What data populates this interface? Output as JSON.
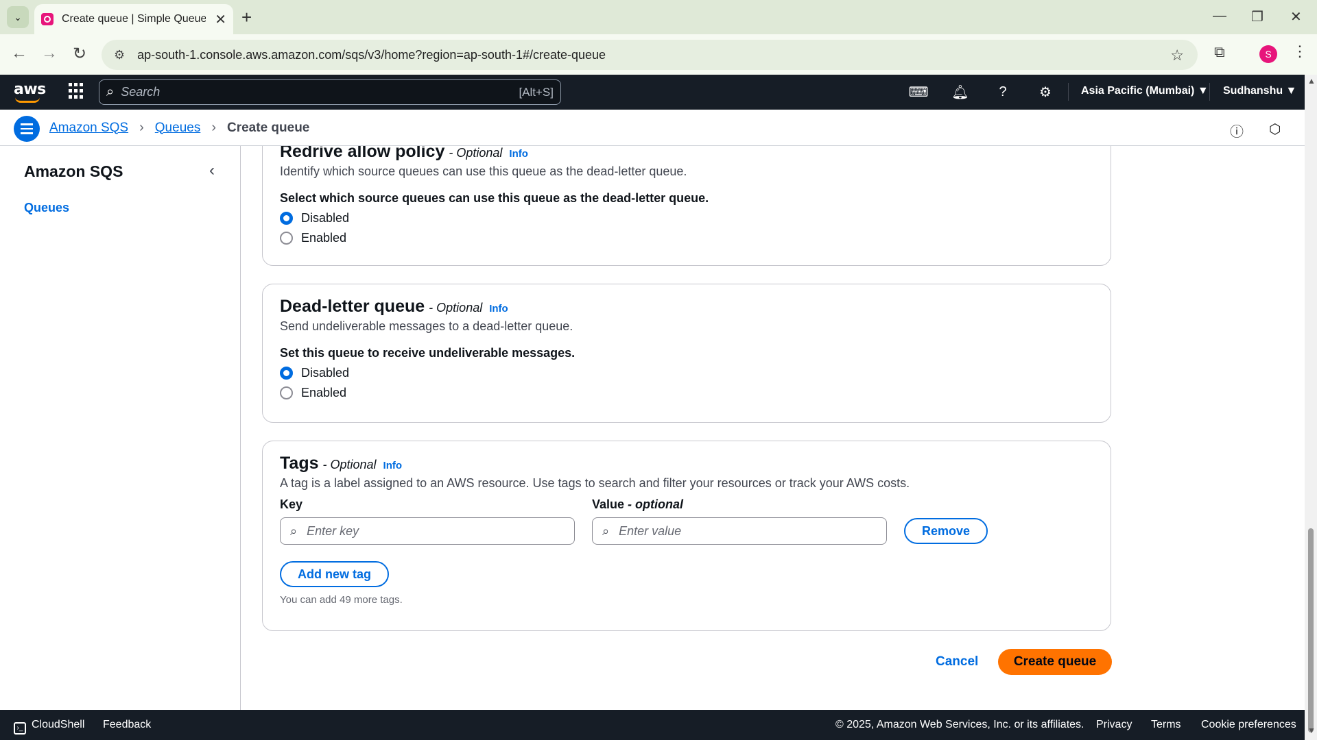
{
  "browser": {
    "tab_title": "Create queue | Simple Queue Se",
    "url": "ap-south-1.console.aws.amazon.com/sqs/v3/home?region=ap-south-1#/create-queue",
    "profile_initial": "S"
  },
  "topnav": {
    "logo": "aws",
    "search_placeholder": "Search",
    "search_shortcut": "[Alt+S]",
    "region": "Asia Pacific (Mumbai) ▼",
    "user": "Sudhanshu ▼"
  },
  "breadcrumb": {
    "items": [
      "Amazon SQS",
      "Queues"
    ],
    "current": "Create queue"
  },
  "sidebar": {
    "title": "Amazon SQS",
    "links": [
      "Queues"
    ]
  },
  "redrive": {
    "title": "Redrive allow policy",
    "optional": "- Optional",
    "info": "Info",
    "description": "Identify which source queues can use this queue as the dead-letter queue.",
    "label": "Select which source queues can use this queue as the dead-letter queue.",
    "options": [
      "Disabled",
      "Enabled"
    ],
    "selected": "Disabled"
  },
  "dlq": {
    "title": "Dead-letter queue",
    "optional": "- Optional",
    "info": "Info",
    "description": "Send undeliverable messages to a dead-letter queue.",
    "label": "Set this queue to receive undeliverable messages.",
    "options": [
      "Disabled",
      "Enabled"
    ],
    "selected": "Disabled"
  },
  "tags": {
    "title": "Tags",
    "optional": "- Optional",
    "info": "Info",
    "description": "A tag is a label assigned to an AWS resource. Use tags to search and filter your resources or track your AWS costs.",
    "key_label": "Key",
    "value_label": "Value",
    "value_optional": "- optional",
    "key_placeholder": "Enter key",
    "value_placeholder": "Enter value",
    "remove_label": "Remove",
    "add_label": "Add new tag",
    "hint": "You can add 49 more tags."
  },
  "actions": {
    "cancel": "Cancel",
    "create": "Create queue"
  },
  "footer": {
    "cloudshell": "CloudShell",
    "feedback": "Feedback",
    "copyright": "© 2025, Amazon Web Services, Inc. or its affiliates.",
    "privacy": "Privacy",
    "terms": "Terms",
    "cookies": "Cookie preferences"
  },
  "colors": {
    "link": "#006ce0",
    "primary_button": "#ff7300",
    "nav_bg": "#161d26"
  }
}
